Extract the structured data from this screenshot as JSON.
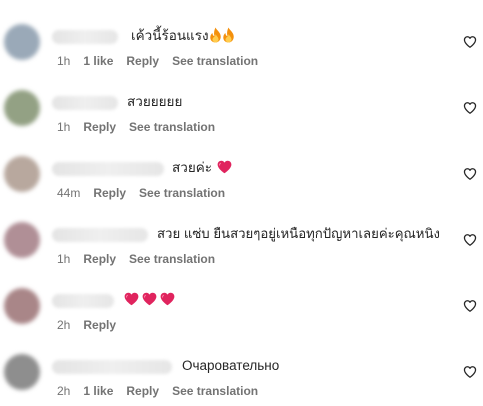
{
  "comments": [
    {
      "text": "เค้วนี้ร้อนแรง",
      "emojis": [
        "fire-icon",
        "fire-icon"
      ],
      "time": "1h",
      "likes": "1 like",
      "reply": "Reply",
      "see_translation": "See translation",
      "avatar_color": "#9aa9b8"
    },
    {
      "text": "สวยยยยย",
      "emojis": [],
      "time": "1h",
      "likes": "",
      "reply": "Reply",
      "see_translation": "See translation",
      "avatar_color": "#93a184"
    },
    {
      "text": "สวยค่ะ",
      "emojis": [
        "red-heart-icon"
      ],
      "time": "44m",
      "likes": "",
      "reply": "Reply",
      "see_translation": "See translation",
      "avatar_color": "#b8a89e"
    },
    {
      "text": "สวย แซ่บ ยืนสวยๆอยู่เหนือทุกปัญหาเลยค่ะคุณหนิง",
      "emojis": [],
      "time": "1h",
      "likes": "",
      "reply": "Reply",
      "see_translation": "See translation",
      "avatar_color": "#b08f96"
    },
    {
      "text": "",
      "emojis": [
        "red-heart-icon",
        "red-heart-icon",
        "red-heart-icon"
      ],
      "time": "2h",
      "likes": "",
      "reply": "Reply",
      "see_translation": "",
      "avatar_color": "#a98688"
    },
    {
      "text": "Очаровательно",
      "emojis": [],
      "time": "2h",
      "likes": "1 like",
      "reply": "Reply",
      "see_translation": "See translation",
      "avatar_color": "#8e8e8e"
    }
  ],
  "colors": {
    "text": "#262626",
    "secondary": "#737373",
    "heart_emoji": "#e0245e"
  }
}
